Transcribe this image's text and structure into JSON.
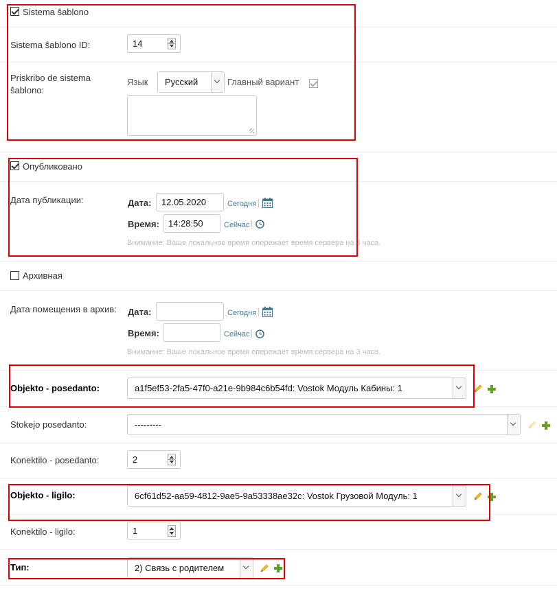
{
  "system_template": {
    "checkbox_label": "Sistema ŝablono",
    "checked": true,
    "id_label": "Sistema ŝablono ID:",
    "id_value": "14",
    "desc_label": "Priskribo de sistema ŝablono:",
    "lang_label": "Язык",
    "lang_value": "Русский",
    "main_variant_label": "Главный вариант",
    "main_variant_checked": true,
    "desc_value": ""
  },
  "published": {
    "checkbox_label": "Опубликовано",
    "checked": true,
    "date_label": "Дата публикации:",
    "date_field_label": "Дата:",
    "date_value": "12.05.2020",
    "today_link": "Сегодня",
    "time_field_label": "Время:",
    "time_value": "14:28:50",
    "now_link": "Сейчас",
    "tz_warning": "Внимание: Ваше локальное время опережает время сервера на 3 часа."
  },
  "archive": {
    "checkbox_label": "Архивная",
    "checked": false,
    "date_label": "Дата помещения в архив:",
    "date_field_label": "Дата:",
    "date_value": "",
    "today_link": "Сегодня",
    "time_field_label": "Время:",
    "time_value": "",
    "now_link": "Сейчас",
    "tz_warning": "Внимание: Ваше локальное время опережает время сервера на 3 часа."
  },
  "owner_object": {
    "label": "Objekto - posedanto:",
    "value": "a1f5ef53-2fa5-47f0-a21e-9b984c6b54fd: Vostok Модуль Кабины: 1"
  },
  "owner_stock": {
    "label": "Stokejo posedanto:",
    "value": "---------"
  },
  "owner_connector": {
    "label": "Konektilo - posedanto:",
    "value": "2"
  },
  "link_object": {
    "label": "Objekto - ligilo:",
    "value": "6cf61d52-aa59-4812-9ae5-9a53338ae32c: Vostok Грузовой Модуль: 1"
  },
  "link_connector": {
    "label": "Konektilo - ligilo:",
    "value": "1"
  },
  "type": {
    "label": "Тип:",
    "value": "2) Связь с родителем"
  },
  "colors": {
    "link": "#447e9b",
    "highlight": "#e00000",
    "add": "#5fa225",
    "edit": "#f0c419"
  }
}
